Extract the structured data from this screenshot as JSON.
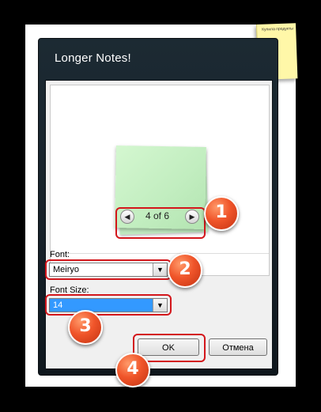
{
  "background_note": {
    "text": "Купила продукты"
  },
  "window": {
    "title": "Longer Notes!"
  },
  "preview": {
    "page_indicator": "4 of 6",
    "prev_icon": "prev-arrow-icon",
    "next_icon": "next-arrow-icon"
  },
  "font": {
    "label": "Font:",
    "value": "Meiryo"
  },
  "font_size": {
    "label": "Font Size:",
    "value": "14"
  },
  "buttons": {
    "ok": "OK",
    "cancel": "Отмена"
  },
  "callouts": {
    "one": "1",
    "two": "2",
    "three": "3",
    "four": "4"
  },
  "colors": {
    "callout": "#e8542a",
    "highlight": "#d3161b",
    "selection": "#3399ff"
  }
}
